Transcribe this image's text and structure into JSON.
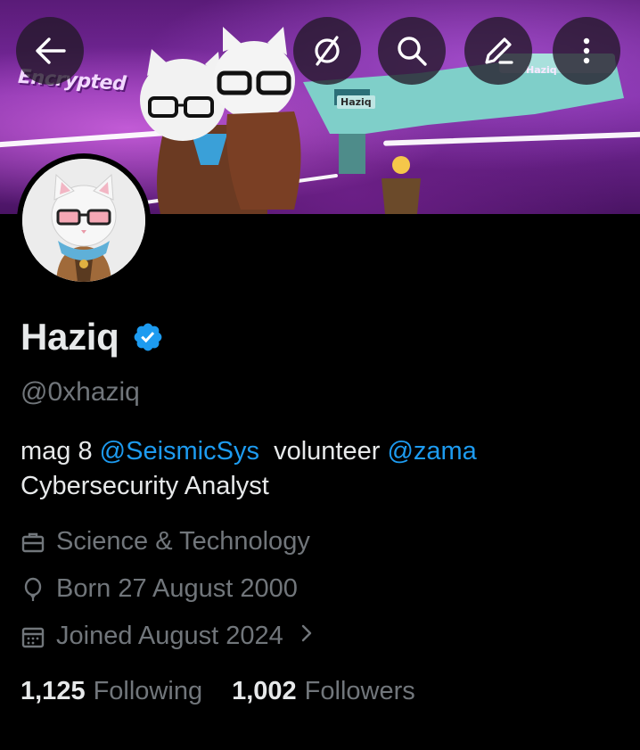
{
  "banner": {
    "text": "Encrypted",
    "tag1": "Haziq",
    "tag2": "Haziq"
  },
  "nav": {
    "back_icon": "arrow-left-icon",
    "mute_icon": "slashed-circle-icon",
    "search_icon": "search-icon",
    "edit_icon": "pencil-icon",
    "more_icon": "vertical-dots-icon"
  },
  "profile": {
    "name": "Haziq",
    "verified": true,
    "handle": "@0xhaziq",
    "bio": {
      "line1_prefix": "mag 8 ",
      "mention1": "@SeismicSys",
      "line1_middle": "  volunteer ",
      "mention2": "@zama",
      "line2": "Cybersecurity Analyst"
    },
    "category": "Science & Technology",
    "birthday": "Born 27 August 2000",
    "joined": "Joined August 2024",
    "following_count": "1,125",
    "following_label": "Following",
    "followers_count": "1,002",
    "followers_label": "Followers"
  },
  "colors": {
    "background": "#000000",
    "text_primary": "#e7e9ea",
    "text_secondary": "#71767b",
    "accent": "#1d9bf0",
    "banner_purple": "#7d2ba3"
  }
}
